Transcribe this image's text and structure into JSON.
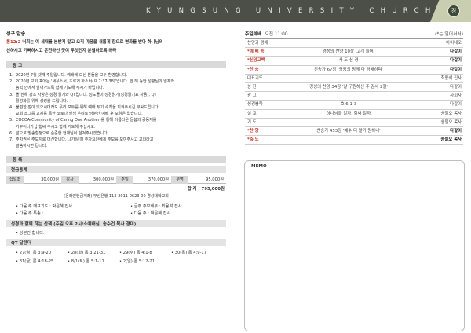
{
  "header": {
    "title": "KYUNGSUNG UNIVERSITY CHURCH",
    "logo": "경"
  },
  "verse": {
    "title": "성구 암송",
    "ref": "롬12:2",
    "line1": "너희는 이 세대를 본받지 말고 오직 마음을 새롭게 함으로 변화를 받아 하나님의",
    "line2": "선하시고 기뻐하시고 온전하신 뜻이 무엇인지 분별하도록 하라"
  },
  "notice": {
    "heading": "광      고",
    "items": [
      {
        "num": "1.",
        "text": "2020년 7월 넷째 주일입니다. 예배에 오신 분들을 모두 환영합니다."
      },
      {
        "num": "2.",
        "text": "2020년 교회 표어는 '새우소서, 초르게 하소서(요 7:37-38)'입니다. 한 해 동안 성령님의 임재와"
      },
      {
        "num": "",
        "text": "능력 안에서 살아가도록 함께 기도해 주시기 바랍니다."
      },
      {
        "num": "3.",
        "text": "올 한해 강조 사항은 성경 읽기와 QT입니다. 성도들이 성경읽기(성경읽기표 사용), QT"
      },
      {
        "num": "",
        "text": "활성화를 위해 성령을 드립니다."
      },
      {
        "num": "4.",
        "text": "불편한 점이 있으시더라도 우리 모두를 위해 예배 두기 수칙을 지켜주시길 부탁드립니다."
      },
      {
        "num": "",
        "text": "교회 소그룹 교제를 통한 코로나 발생 우려로 당분간 예배 후 모임은 없습니다."
      },
      {
        "num": "5.",
        "text": "COCOA(Community of Caring One Another)를 통해 이름다운 돌봄의 공동체를"
      },
      {
        "num": "",
        "text": "가꾸어나가십 힘써 주시고 함께 기도해 주십시오."
      },
      {
        "num": "6.",
        "text": "앞으로 방송철정으로 순준한 헌재님이 섬겨주시겠습니다."
      },
      {
        "num": "7.",
        "text": "주차권은 주보지로 대신합니다. 나가실 때 주차요원에게 주보를 보여주시고 교회라고"
      },
      {
        "num": "",
        "text": "말씀하시면 됩니다."
      }
    ]
  },
  "register": {
    "heading": "등      록"
  },
  "offering": {
    "heading": "현금통계",
    "items": [
      {
        "label": "십일조",
        "value": "30,000원"
      },
      {
        "label": "감사",
        "value": "300,000원"
      },
      {
        "label": "주일",
        "value": "370,000원"
      },
      {
        "label": "무명",
        "value": "95,000원"
      }
    ],
    "total_label": "합   계",
    "total_value": "795,000원",
    "account": "(온라인헌금계좌) 부산은행 113-2011-0623-00 경성대학교회"
  },
  "duty": [
    "• 다음 주 대표기도 : 박은혜 집사",
    "• 금주 주보배부 : 최용석 집사",
    "• 다음 주 특송 :",
    "• 다음 주 : 박은혜 집사"
  ],
  "prayer_walk": {
    "heading": "성경과 함께 하는 산책 (주일 오후 2시/소예배실, 송수건 목사 경미)",
    "text": "• 당분간 합니다."
  },
  "qt": {
    "heading": "QT 달란더",
    "items": [
      "• 27(월) 롬 3:9-20",
      "• 28(화) 롬 3:21-31",
      "• 29(수) 롬 4:1-8",
      "• 30(목) 롬 4:9-17",
      "• 31(금) 롬 4:18-25",
      "• 8/1(토) 롬 5:1-11",
      "• 2(일) 롬 5:12-21"
    ]
  },
  "worship": {
    "title": "주일예배",
    "time": "오전 11:00",
    "note": "(*는 일어서서)",
    "rows": [
      {
        "item": "찬양과 경배",
        "content": "",
        "person": "아이네오",
        "hl": false
      },
      {
        "item": "예 배 송",
        "content": "경성의 찬양 10장 '고개 들어'",
        "person": "다같이",
        "hl": true
      },
      {
        "item": "신앙고백",
        "content": "사 도 신 경",
        "person": "다같이",
        "hl": true
      },
      {
        "item": "찬    송",
        "content": "찬송가 67장 '영광의 왕께 다 경배하며'",
        "person": "다같이",
        "hl": true
      },
      {
        "item": "대표기도",
        "content": "",
        "person": "최용석 집사",
        "hl": false
      },
      {
        "item": "봉    헌",
        "content": "경성의 찬양 34장 '날 구원하신 주 감사 2절'",
        "person": "다같이",
        "hl": false
      },
      {
        "item": "광    고",
        "content": "",
        "person": "사회자",
        "hl": false
      },
      {
        "item": "성경봉독",
        "content": "호 6:1-3",
        "person": "다같이",
        "hl": false
      },
      {
        "item": "설    교",
        "content": "하나님을 알자, 힘써 알자",
        "person": "송필오 목사",
        "hl": false
      },
      {
        "item": "기    도",
        "content": "",
        "person": "송필오 목사",
        "hl": false
      },
      {
        "item": "찬    양",
        "content": "찬송가 453장 '예수 더 알기 원하네'",
        "person": "다같이",
        "hl": true
      },
      {
        "item": "축    도",
        "content": "",
        "person": "송필오 목사",
        "hl": true
      }
    ]
  },
  "memo": {
    "label": "MEMO"
  }
}
